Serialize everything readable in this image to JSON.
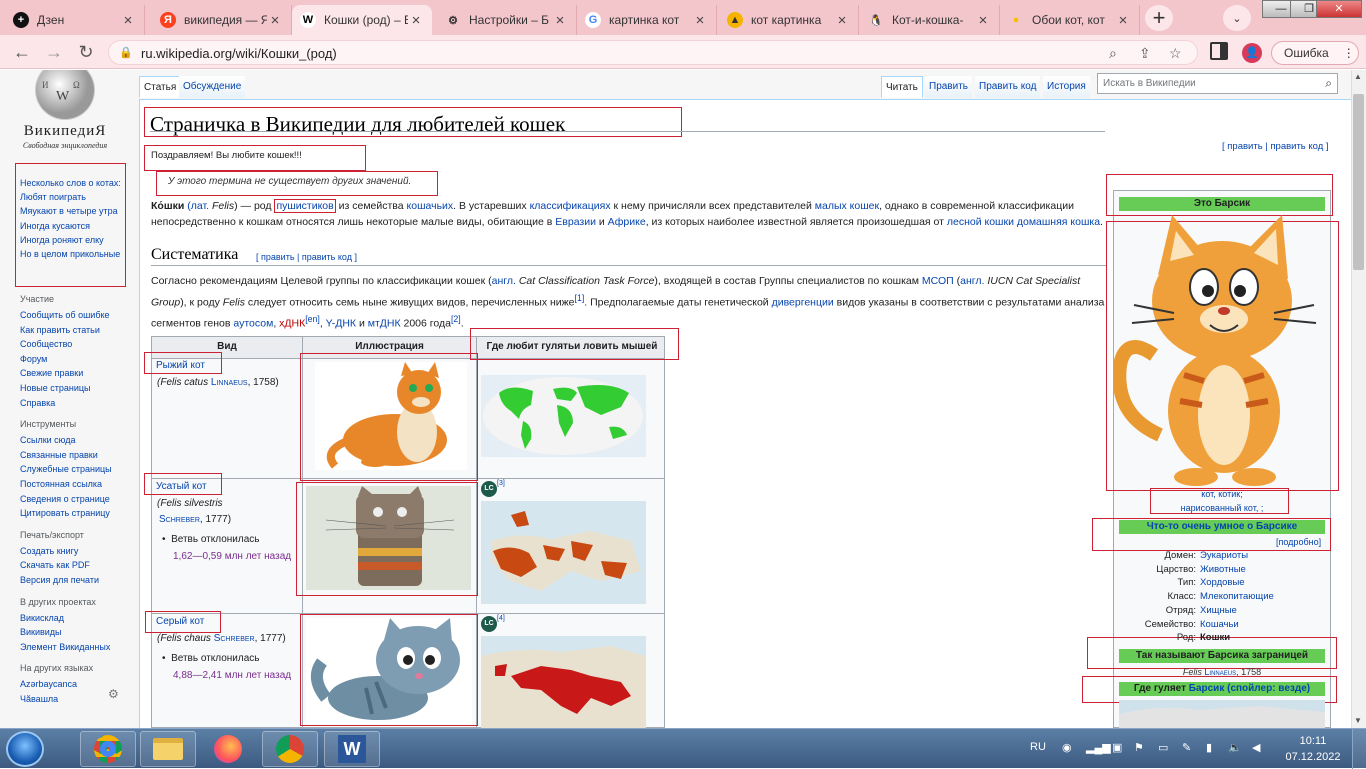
{
  "tabs": [
    {
      "title": "Дзен",
      "icon": "+",
      "icon_bg": "#111",
      "icon_color": "#fff"
    },
    {
      "title": "википедия — Я",
      "icon": "Я",
      "icon_bg": "#fc3f1d",
      "icon_color": "#fff"
    },
    {
      "title": "Кошки (род) – В",
      "icon": "W",
      "icon_bg": "#fff",
      "icon_color": "#000"
    },
    {
      "title": "Настройки – Б",
      "icon": "⚙",
      "icon_bg": "transparent",
      "icon_color": "#333"
    },
    {
      "title": "картинка кот",
      "icon": "G",
      "icon_bg": "#fff",
      "icon_color": "#4285f4"
    },
    {
      "title": "кот картинка",
      "icon": "▲",
      "icon_bg": "#f6b400",
      "icon_color": "#333"
    },
    {
      "title": "Кот-и-кошка-",
      "icon": "🐧",
      "icon_bg": "transparent",
      "icon_color": "#333"
    },
    {
      "title": "Обои кот, кот",
      "icon": "●",
      "icon_bg": "transparent",
      "icon_color": "#f2c200"
    }
  ],
  "active_tab": 2,
  "url": "ru.wikipedia.org/wiki/Кошки_(род)",
  "error_button": "Ошибка",
  "profile_initial": "👤",
  "wiki": {
    "name": "ВикипедиЯ",
    "tagline": "Свободная энциклопедия",
    "custom_links": [
      "Несколько слов о котах:",
      "Любят поиграть",
      "Мяукают в четыре утра",
      "Иногда кусаются",
      "Иногда роняют елку",
      "Но в целом прикольные"
    ],
    "sections": [
      {
        "title": "Участие",
        "items": [
          "Сообщить об ошибке",
          "Как править статьи",
          "Сообщество",
          "Форум",
          "Свежие правки",
          "Новые страницы",
          "Справка"
        ]
      },
      {
        "title": "Инструменты",
        "items": [
          "Ссылки сюда",
          "Связанные правки",
          "Служебные страницы",
          "Постоянная ссылка",
          "Сведения о странице",
          "Цитировать страницу"
        ]
      },
      {
        "title": "Печать/экспорт",
        "items": [
          "Создать книгу",
          "Скачать как PDF",
          "Версия для печати"
        ]
      },
      {
        "title": "В других проектах",
        "items": [
          "Викисклад",
          "Викивиды",
          "Элемент Викиданных"
        ]
      },
      {
        "title": "На других языках",
        "items": [
          "Azərbaycanca",
          "Чӑвашла"
        ]
      }
    ],
    "page_tabs_left": [
      "Статья",
      "Обсуждение"
    ],
    "page_tabs_right": [
      "Читать",
      "Править",
      "Править код",
      "История"
    ],
    "search_placeholder": "Искать в Википедии",
    "heading": "Страничка в Википедии для любителей кошек",
    "congrats": "Поздравляем! Вы любите кошек!!!",
    "edit_links": "[ править | править код ]",
    "disambig": "У этого термина не существует других значений.",
    "intro": {
      "p1": "Ко́шки",
      "p2": "(лат. Felis) — род ",
      "p3": "пушистиков",
      "p4": " из семейства ",
      "p5": "кошачьих",
      "p6": ". В устаревших ",
      "p7": "классификациях",
      "p8": " к нему причисляли всех представителей ",
      "p9": "малых кошек",
      "p10": ", однако в современной классификации",
      "line2": "непосредственно к кошкам относятся лишь некоторые малые виды, обитающие в ",
      "l2a": "Евразии",
      "l2b": " и ",
      "l2c": "Африке",
      "l2d": ", из которых наиболее известной является произошедшая от ",
      "l2e": "лесной кошки",
      "l2f": "домашняя кошка",
      "l2g": "."
    },
    "systematics_title": "Систематика",
    "systematics_edit": "[ править | править код ]",
    "sys_text": {
      "a": "Согласно рекомендациям Целевой группы по классификации кошек (",
      "b": "англ.",
      "c": " Cat Classification Task Force",
      "d": "), входящей в состав Группы специалистов по кошкам ",
      "e": "МСОП",
      "f": " (",
      "g": "англ.",
      "h": " IUCN Cat Specialist",
      "i": "Group",
      "j": "), к роду ",
      "k": "Felis",
      "l": " следует относить семь ныне живущих видов, перечисленных ниже",
      "m": "[1]",
      "n": ". Предполагаемые даты генетической ",
      "o": "дивергенции",
      "p": " видов указаны в соответствии с результатами анализа",
      "q": "сегментов генов ",
      "r": "аутосом",
      "s": ", ",
      "t": "хДНК",
      "u": "[en]",
      "v": ", ",
      "w": "Y-ДНК",
      "x": " и ",
      "y": "мтДНК",
      "z": " 2006 года",
      "zz": "[2]",
      "zzz": "."
    },
    "table": {
      "headers": [
        "Вид",
        "Иллюстрация",
        "Где любит гулятьи ловить мышей"
      ],
      "rows": [
        {
          "name": "Рыжий кот",
          "latin": "(Felis catus ",
          "author": "Linnaeus",
          "year": ", 1758)",
          "branch": "",
          "range": "",
          "ref": ""
        },
        {
          "name": "Усатый кот",
          "latin": "(Felis silvestris",
          "author": "Schreber",
          "year": ", 1777)",
          "branch": "Ветвь отклонилась",
          "range": "1,62—0,59 млн лет назад",
          "ref": "[3]"
        },
        {
          "name": "Серый кот",
          "latin": "(Felis chaus ",
          "author": "Schreber",
          "year": ", 1777)",
          "branch": "Ветвь отклонилась",
          "range": "4,88—2,41 млн лет назад",
          "ref": "[4]"
        }
      ],
      "lc_label": "LC"
    },
    "infobox": {
      "title": "Это Барсик",
      "caption1": "кот, котик;",
      "caption2": "нарисованный кот, ;",
      "smart": "Что-то очень умное о Барсике",
      "more": "[подробно]",
      "rows": [
        {
          "k": "Домен:",
          "v": "Эукариоты"
        },
        {
          "k": "Царство:",
          "v": "Животные"
        },
        {
          "k": "Тип:",
          "v": "Хордовые"
        },
        {
          "k": "Класс:",
          "v": "Млекопитающие"
        },
        {
          "k": "Отряд:",
          "v": "Хищные"
        },
        {
          "k": "Семейство:",
          "v": "Кошачьи"
        },
        {
          "k": "Род:",
          "v": "Кошки"
        }
      ],
      "abroad": "Так называют Барсика заграницей",
      "latin": "Felis ",
      "latin_author": "Linnaeus",
      "latin_year": ", 1758",
      "walks_a": "Где гуляет ",
      "walks_b": "Барсик",
      "walks_c": " (спойлер: везде)"
    }
  },
  "taskbar": {
    "lang": "RU",
    "time": "10:11",
    "date": "07.12.2022"
  },
  "colors": {
    "tabbar": "#f3c6cc",
    "toolbar": "#fce6e9",
    "accent_red_box": "#cc2233",
    "green_bar": "#66cc55",
    "link": "#0645ad"
  }
}
